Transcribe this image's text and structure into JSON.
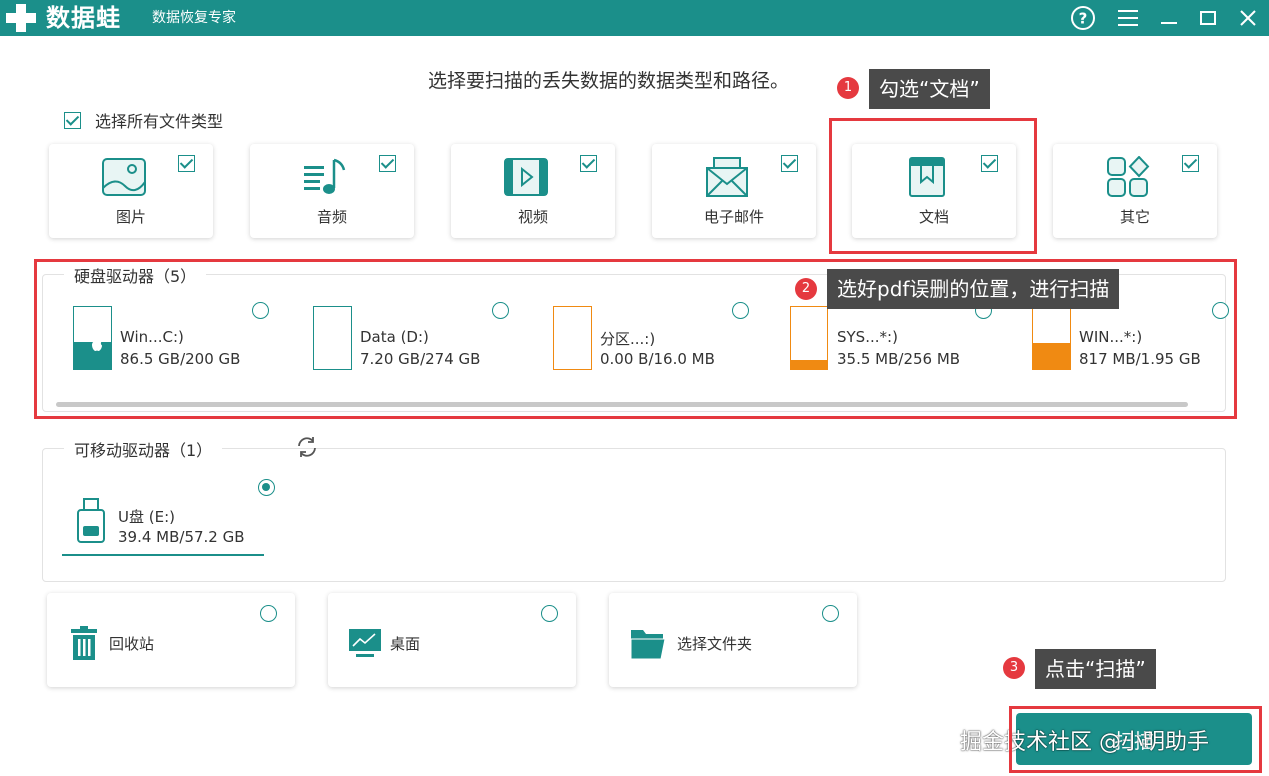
{
  "app": {
    "logo_text": "数据蛙",
    "subtitle": "数据恢复专家",
    "help_symbol": "?",
    "menu_symbol": "☰",
    "min_symbol": "—",
    "max_symbol": "□",
    "close_symbol": "✕"
  },
  "prompt": "选择要扫描的丢失数据的数据类型和路径。",
  "select_all_label": "选择所有文件类型",
  "file_types": [
    {
      "label": "图片",
      "checked": true,
      "icon": "image-icon"
    },
    {
      "label": "音频",
      "checked": true,
      "icon": "music-icon"
    },
    {
      "label": "视频",
      "checked": true,
      "icon": "video-icon"
    },
    {
      "label": "电子邮件",
      "checked": true,
      "icon": "email-icon"
    },
    {
      "label": "文档",
      "checked": true,
      "icon": "document-icon"
    },
    {
      "label": "其它",
      "checked": true,
      "icon": "other-icon"
    }
  ],
  "hard_drives": {
    "title": "硬盘驱动器（5）",
    "items": [
      {
        "name": "Win...C:)",
        "size": "86.5 GB/200 GB",
        "used_fraction": 0.43,
        "color": "#1b8f8a"
      },
      {
        "name": "Data (D:)",
        "size": "7.20 GB/274 GB",
        "used_fraction": 0.0,
        "color": "#1b8f8a"
      },
      {
        "name": "分区...:)",
        "size": "0.00  B/16.0 MB",
        "used_fraction": 0.0,
        "color": "#f08a12"
      },
      {
        "name": "SYS...*:)",
        "size": "35.5 MB/256 MB",
        "used_fraction": 0.14,
        "color": "#f08a12"
      },
      {
        "name": "WIN...*:)",
        "size": "817 MB/1.95 GB",
        "used_fraction": 0.42,
        "color": "#f08a12"
      }
    ]
  },
  "removable_drives": {
    "title": "可移动驱动器（1）",
    "items": [
      {
        "name": "U盘 (E:)",
        "size": "39.4 MB/57.2 GB",
        "selected": true
      }
    ]
  },
  "locations": [
    {
      "label": "回收站",
      "icon": "recycle-bin-icon"
    },
    {
      "label": "桌面",
      "icon": "desktop-icon"
    },
    {
      "label": "选择文件夹",
      "icon": "folder-icon"
    }
  ],
  "annotations": [
    {
      "num": "1",
      "text": "勾选“文档”"
    },
    {
      "num": "2",
      "text": "选好pdf误删的位置，进行扫描"
    },
    {
      "num": "3",
      "text": "点击“扫描”"
    }
  ],
  "scan_button": "扫描",
  "watermark": "掘金技术社区 @小明助手",
  "colors": {
    "accent": "#1b8f8a",
    "warning": "#f08a12",
    "annotation_red": "#e5393f"
  }
}
